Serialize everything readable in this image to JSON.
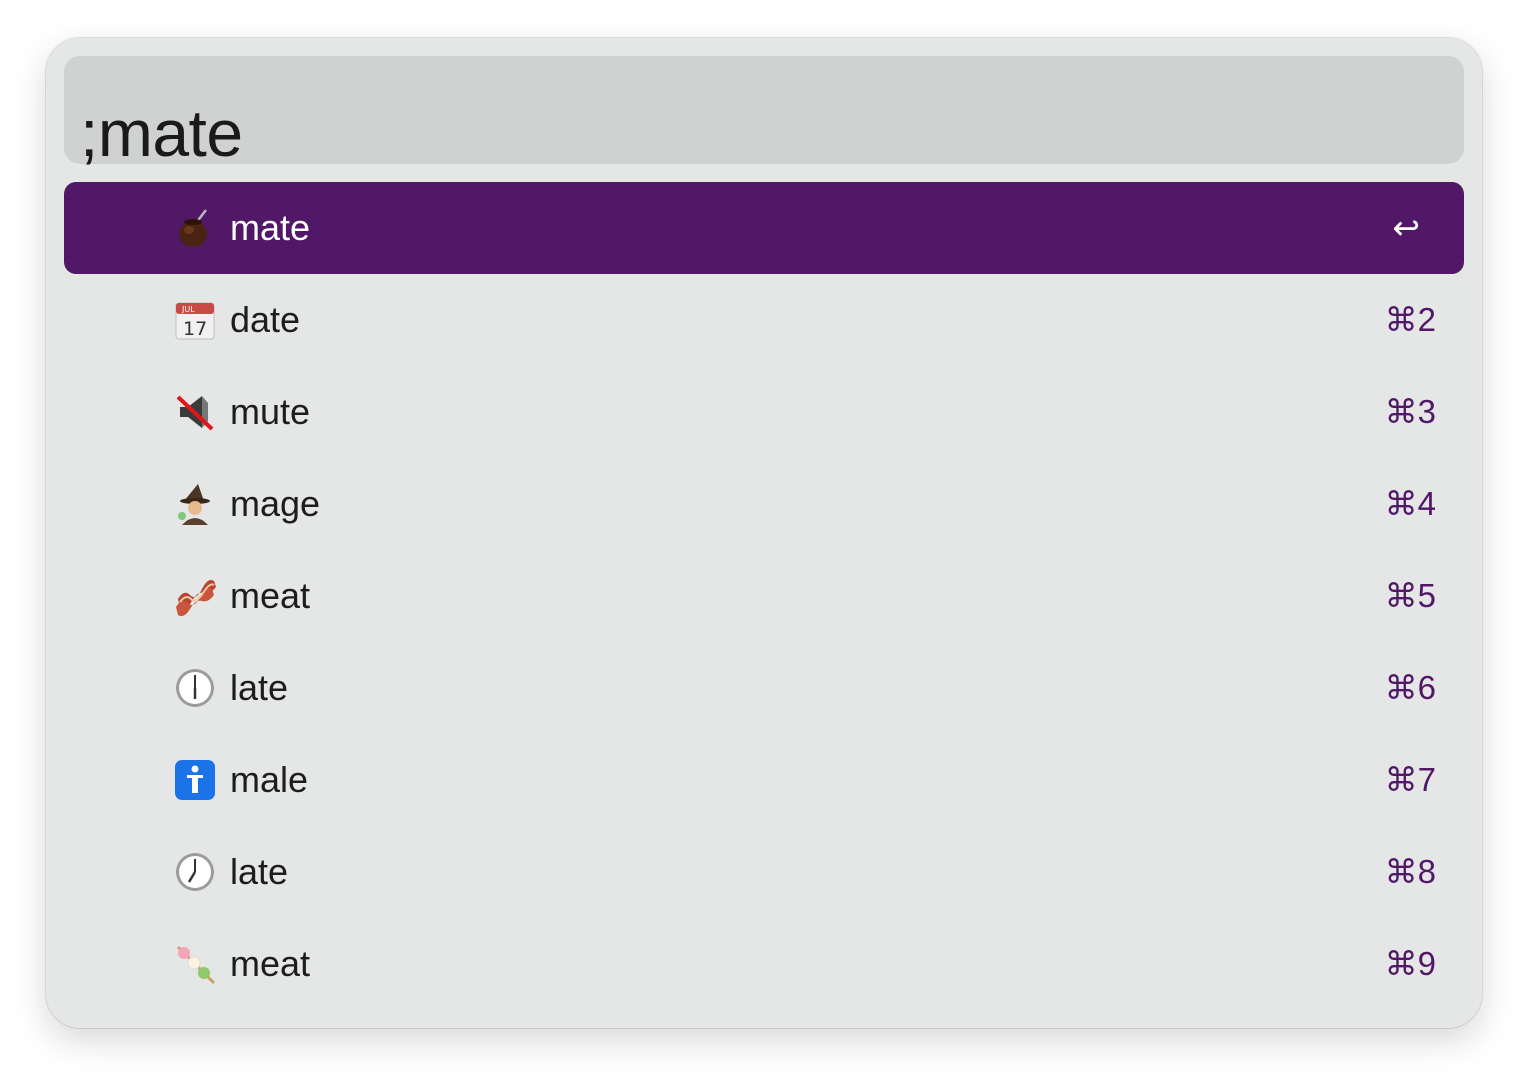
{
  "search": {
    "query": ";mate"
  },
  "results": [
    {
      "emoji": "mate-icon",
      "label": "mate",
      "shortcut": "↩",
      "selected": true
    },
    {
      "emoji": "calendar-icon",
      "label": "date",
      "shortcut": "⌘2",
      "selected": false
    },
    {
      "emoji": "muted-speaker-icon",
      "label": "mute",
      "shortcut": "⌘3",
      "selected": false
    },
    {
      "emoji": "mage-icon",
      "label": "mage",
      "shortcut": "⌘4",
      "selected": false
    },
    {
      "emoji": "bacon-icon",
      "label": "meat",
      "shortcut": "⌘5",
      "selected": false
    },
    {
      "emoji": "clock-six-icon",
      "label": "late",
      "shortcut": "⌘6",
      "selected": false
    },
    {
      "emoji": "man-symbol-icon",
      "label": "male",
      "shortcut": "⌘7",
      "selected": false
    },
    {
      "emoji": "clock-seven-icon",
      "label": "late",
      "shortcut": "⌘8",
      "selected": false
    },
    {
      "emoji": "dango-icon",
      "label": "meat",
      "shortcut": "⌘9",
      "selected": false
    }
  ],
  "colors": {
    "selected_background": "#521868",
    "shortcut_text": "#521868",
    "panel_background": "#e5e6e6",
    "search_background": "#d0d1d1"
  }
}
